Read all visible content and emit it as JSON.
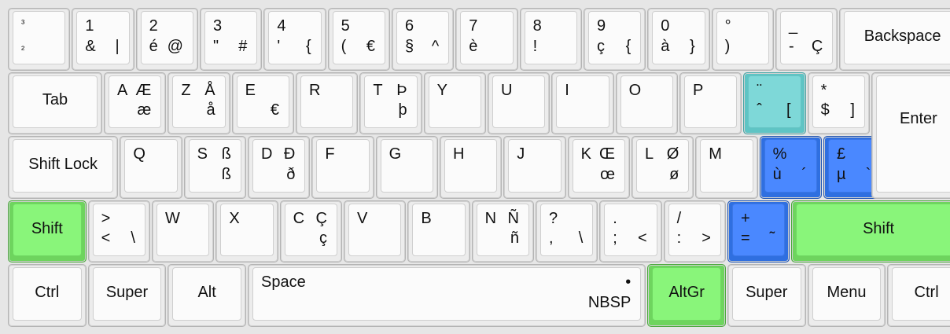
{
  "keyboard": {
    "rows": [
      [
        {
          "name": "key-superscript3",
          "tl": "³",
          "bl": "²",
          "small": true
        },
        {
          "name": "key-1",
          "tl": "1",
          "bl": "&",
          "br": "|"
        },
        {
          "name": "key-2",
          "tl": "2",
          "bl": "é",
          "br": "@"
        },
        {
          "name": "key-3",
          "tl": "3",
          "bl": "\"",
          "br": "#"
        },
        {
          "name": "key-4",
          "tl": "4",
          "bl": "'",
          "br": "{"
        },
        {
          "name": "key-5",
          "tl": "5",
          "bl": "(",
          "br": "€"
        },
        {
          "name": "key-6",
          "tl": "6",
          "bl": "§",
          "br": "^"
        },
        {
          "name": "key-7",
          "tl": "7",
          "bl": "è"
        },
        {
          "name": "key-8",
          "tl": "8",
          "bl": "!"
        },
        {
          "name": "key-9",
          "tl": "9",
          "bl": "ç",
          "br": "{"
        },
        {
          "name": "key-0",
          "tl": "0",
          "bl": "à",
          "br": "}"
        },
        {
          "name": "key-degree",
          "tl": "°",
          "bl": ")"
        },
        {
          "name": "key-underscore",
          "tl": "_",
          "bl": "-",
          "br": "Ç"
        },
        {
          "name": "key-backspace",
          "c": "Backspace",
          "w": 2
        }
      ],
      [
        {
          "name": "key-tab",
          "c": "Tab",
          "w": 1.5
        },
        {
          "name": "key-a",
          "tl": "A",
          "tr": "Æ",
          "br": "æ"
        },
        {
          "name": "key-z",
          "tl": "Z",
          "tr": "Å",
          "br": "å"
        },
        {
          "name": "key-e",
          "tl": "E",
          "br": "€"
        },
        {
          "name": "key-r",
          "tl": "R"
        },
        {
          "name": "key-t",
          "tl": "T",
          "tr": "Þ",
          "br": "þ"
        },
        {
          "name": "key-y",
          "tl": "Y"
        },
        {
          "name": "key-u",
          "tl": "U"
        },
        {
          "name": "key-i",
          "tl": "I"
        },
        {
          "name": "key-o",
          "tl": "O"
        },
        {
          "name": "key-p",
          "tl": "P"
        },
        {
          "name": "key-circumflex",
          "tl": "¨",
          "bl": "ˆ",
          "br": "[",
          "color": "teal"
        },
        {
          "name": "key-star",
          "tl": "*",
          "bl": "$",
          "br": "]"
        }
      ],
      [
        {
          "name": "key-shift-lock",
          "c": "Shift Lock",
          "w": 1.75
        },
        {
          "name": "key-q",
          "tl": "Q"
        },
        {
          "name": "key-s",
          "tl": "S",
          "tr": "ß",
          "br": "ß"
        },
        {
          "name": "key-d",
          "tl": "D",
          "tr": "Đ",
          "br": "ð"
        },
        {
          "name": "key-f",
          "tl": "F"
        },
        {
          "name": "key-g",
          "tl": "G"
        },
        {
          "name": "key-h",
          "tl": "H"
        },
        {
          "name": "key-j",
          "tl": "J"
        },
        {
          "name": "key-k",
          "tl": "K",
          "tr": "Œ",
          "br": "œ"
        },
        {
          "name": "key-l",
          "tl": "L",
          "tr": "Ø",
          "br": "ø"
        },
        {
          "name": "key-m",
          "tl": "M"
        },
        {
          "name": "key-percent",
          "tl": "%",
          "bl": "ù",
          "br": "´",
          "color": "blue"
        },
        {
          "name": "key-pound",
          "tl": "£",
          "bl": "µ",
          "br": "`",
          "color": "blue"
        }
      ],
      [
        {
          "name": "key-shift-left",
          "c": "Shift",
          "w": 1.25,
          "color": "green"
        },
        {
          "name": "key-angle",
          "tl": ">",
          "bl": "<",
          "br": "\\"
        },
        {
          "name": "key-w",
          "tl": "W"
        },
        {
          "name": "key-x",
          "tl": "X"
        },
        {
          "name": "key-c",
          "tl": "C",
          "tr": "Ç",
          "br": "ç"
        },
        {
          "name": "key-v",
          "tl": "V"
        },
        {
          "name": "key-b",
          "tl": "B"
        },
        {
          "name": "key-n",
          "tl": "N",
          "tr": "Ñ",
          "br": "ñ"
        },
        {
          "name": "key-question",
          "tl": "?",
          "bl": ",",
          "br": "\\"
        },
        {
          "name": "key-period",
          "tl": ".",
          "bl": ";",
          "br": "<"
        },
        {
          "name": "key-slash",
          "tl": "/",
          "bl": ":",
          "br": ">"
        },
        {
          "name": "key-plus",
          "tl": "+",
          "bl": "=",
          "br": "˜",
          "color": "blue"
        },
        {
          "name": "key-shift-right",
          "c": "Shift",
          "w": 2.75,
          "color": "green"
        }
      ],
      [
        {
          "name": "key-ctrl-left",
          "c": "Ctrl",
          "w": 1.25
        },
        {
          "name": "key-super-left",
          "c": "Super",
          "w": 1.25
        },
        {
          "name": "key-alt",
          "c": "Alt",
          "w": 1.25
        },
        {
          "name": "key-space",
          "tl": "Space",
          "tr": "•",
          "br": "NBSP",
          "w": 6.25
        },
        {
          "name": "key-altgr",
          "c": "AltGr",
          "w": 1.25,
          "color": "green"
        },
        {
          "name": "key-super-right",
          "c": "Super",
          "w": 1.25
        },
        {
          "name": "key-menu",
          "c": "Menu",
          "w": 1.25
        },
        {
          "name": "key-ctrl-right",
          "c": "Ctrl",
          "w": 1.25
        }
      ]
    ],
    "enter": {
      "name": "key-enter",
      "c": "Enter"
    }
  }
}
